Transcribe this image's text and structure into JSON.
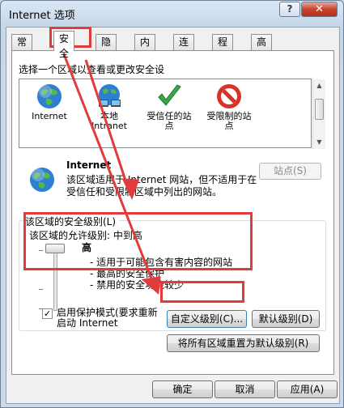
{
  "window": {
    "title": "Internet 选项",
    "help_glyph": "?",
    "close_glyph": "✕"
  },
  "tabs": [
    {
      "label": "常规"
    },
    {
      "label": "安全"
    },
    {
      "label": "隐私"
    },
    {
      "label": "内容"
    },
    {
      "label": "连接"
    },
    {
      "label": "程序"
    },
    {
      "label": "高级"
    }
  ],
  "security": {
    "zone_prompt": "选择一个区域以查看或更改安全设",
    "zones": [
      {
        "label": "Internet",
        "icon": "globe-icon"
      },
      {
        "label": "本地\nIntranet",
        "icon": "intranet-globe-icon"
      },
      {
        "label": "受信任的站\n点",
        "icon": "checkmark-icon"
      },
      {
        "label": "受限制的站\n点",
        "icon": "no-entry-icon"
      }
    ],
    "selected_zone": {
      "name": "Internet",
      "description": "该区域适用于 Internet 网站，但不适用于在受信任和受限制区域中列出的网站。"
    },
    "sites_button": "站点(S)",
    "level_group_title": "该区域的安全级别(L)",
    "allowed_levels": "该区域的允许级别: 中到高",
    "level": {
      "name": "高",
      "points": [
        "- 适用于可能包含有害内容的网站",
        "- 最高的安全保护",
        "- 禁用的安全功能较少"
      ]
    },
    "protected_mode": {
      "checked": true,
      "label": "启用保护模式(要求重新\n启动 Internet"
    },
    "custom_level_button": "自定义级别(C)...",
    "default_level_button": "默认级别(D)",
    "reset_all_button": "将所有区域重置为默认级别(R)"
  },
  "footer": {
    "ok": "确定",
    "cancel": "取消",
    "apply": "应用(A)"
  },
  "annotation_color": "#e23b3b"
}
